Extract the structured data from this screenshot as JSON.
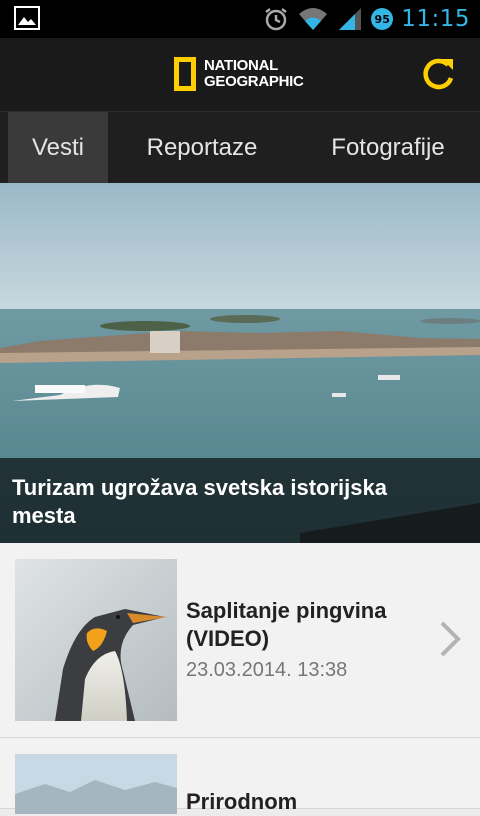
{
  "status_bar": {
    "time": "11:15",
    "battery_level": "95",
    "icons": [
      "gallery-icon",
      "alarm-icon",
      "wifi-icon",
      "signal-icon",
      "battery-icon"
    ]
  },
  "header": {
    "logo_line1": "NATIONAL",
    "logo_line2": "GEOGRAPHIC",
    "accent_color": "#ffce00",
    "refresh_icon": "refresh-icon"
  },
  "tabs": [
    {
      "label": "Vesti",
      "active": true
    },
    {
      "label": "Reportaze",
      "active": false
    },
    {
      "label": "Fotografije",
      "active": false
    }
  ],
  "hero": {
    "title": "Turizam ugrožava svetska istorijska mesta"
  },
  "articles": [
    {
      "title": "Saplitanje pingvina (VIDEO)",
      "date": "23.03.2014. 13:38"
    },
    {
      "title": "Prirodnom ",
      "date": ""
    }
  ]
}
